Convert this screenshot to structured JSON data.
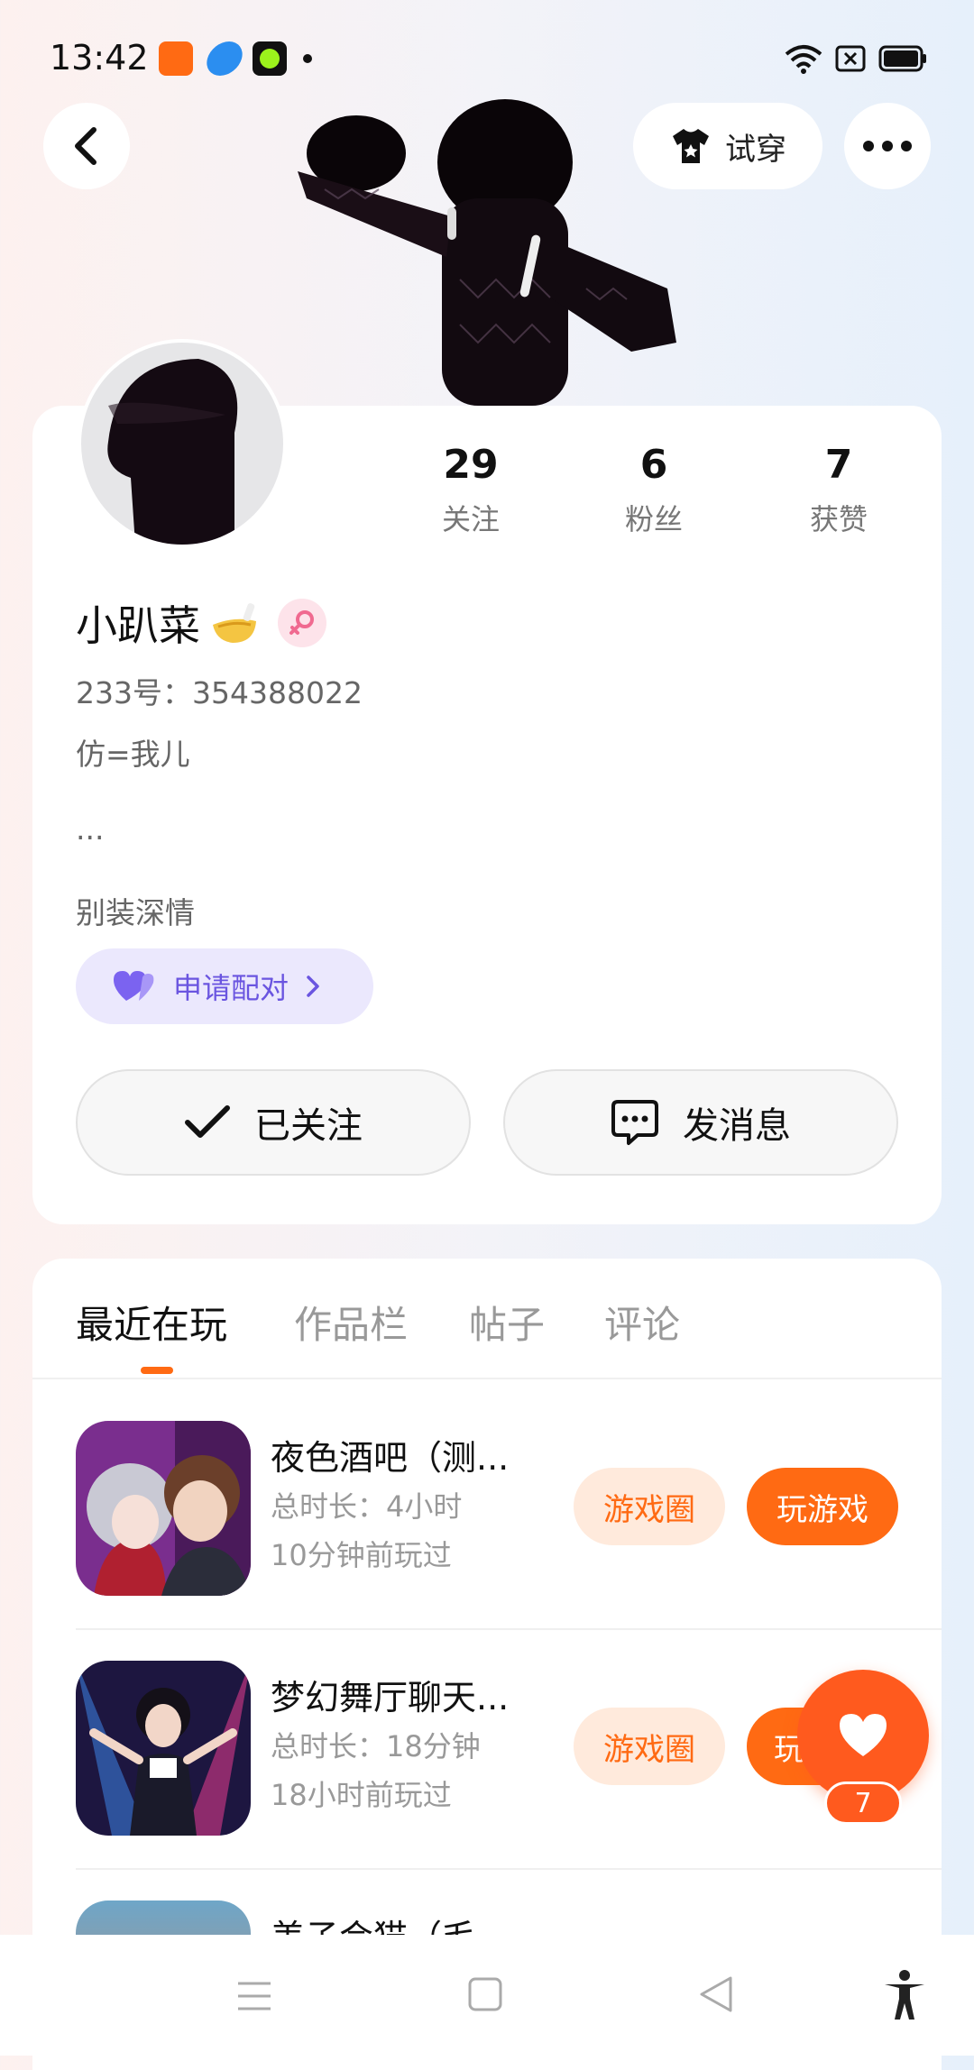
{
  "status_bar": {
    "time": "13:42",
    "notification_icons": [
      "app-icon-orange",
      "app-icon-blue",
      "app-icon-green",
      "dot-icon"
    ],
    "right_icons": [
      "wifi-icon",
      "sim-off-icon",
      "battery-icon"
    ]
  },
  "header": {
    "back_icon": "chevron-left-icon",
    "try_on_label": "试穿",
    "more_icon": "more-dots-icon"
  },
  "profile": {
    "stats": [
      {
        "value": "29",
        "label": "关注"
      },
      {
        "value": "6",
        "label": "粉丝"
      },
      {
        "value": "7",
        "label": "获赞"
      }
    ],
    "nickname": "小趴菜",
    "gender_icon": "female-icon",
    "account_id": "233号：354388022",
    "bio_lines": [
      "仿=我儿",
      "...",
      "别装深情"
    ],
    "pair_button_label": "申请配对",
    "follow_button_label": "已关注",
    "message_button_label": "发消息"
  },
  "tabs": [
    {
      "label": "最近在玩",
      "active": true
    },
    {
      "label": "作品栏",
      "active": false
    },
    {
      "label": "帖子",
      "active": false
    },
    {
      "label": "评论",
      "active": false
    }
  ],
  "games": [
    {
      "name": "夜色酒吧（测...",
      "duration": "总时长：4小时",
      "last_played": "10分钟前玩过",
      "circle_label": "游戏圈",
      "play_label": "玩游戏"
    },
    {
      "name": "梦幻舞厅聊天...",
      "duration": "总时长：18分钟",
      "last_played": "18小时前玩过",
      "circle_label": "游戏圈",
      "play_label": "玩"
    },
    {
      "name": "美子会猫（毛",
      "duration": "",
      "last_played": "",
      "circle_label": "",
      "play_label": ""
    }
  ],
  "like_fab": {
    "count": "7"
  },
  "colors": {
    "accent": "#ff6a13",
    "pair_purple": "#6a55e0",
    "like_red": "#ff5a1e"
  }
}
